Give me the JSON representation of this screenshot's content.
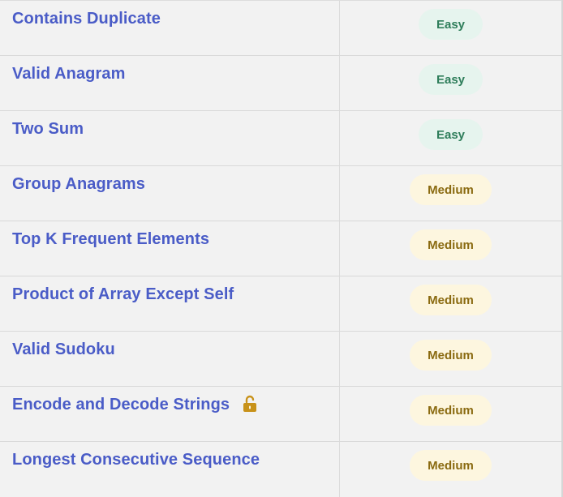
{
  "colors": {
    "link": "#4a5cc7",
    "easy_text": "#2e7d5a",
    "easy_bg": "#e6f4ee",
    "medium_text": "#8a6a10",
    "medium_bg": "#fdf6df",
    "lock": "#c8921a"
  },
  "problems": [
    {
      "title": "Contains Duplicate",
      "difficulty": "Easy",
      "locked": false
    },
    {
      "title": "Valid Anagram",
      "difficulty": "Easy",
      "locked": false
    },
    {
      "title": "Two Sum",
      "difficulty": "Easy",
      "locked": false
    },
    {
      "title": "Group Anagrams",
      "difficulty": "Medium",
      "locked": false
    },
    {
      "title": "Top K Frequent Elements",
      "difficulty": "Medium",
      "locked": false
    },
    {
      "title": "Product of Array Except Self",
      "difficulty": "Medium",
      "locked": false
    },
    {
      "title": "Valid Sudoku",
      "difficulty": "Medium",
      "locked": false
    },
    {
      "title": "Encode and Decode Strings",
      "difficulty": "Medium",
      "locked": true,
      "icon": "unlocked-padlock-icon"
    },
    {
      "title": "Longest Consecutive Sequence",
      "difficulty": "Medium",
      "locked": false
    }
  ]
}
